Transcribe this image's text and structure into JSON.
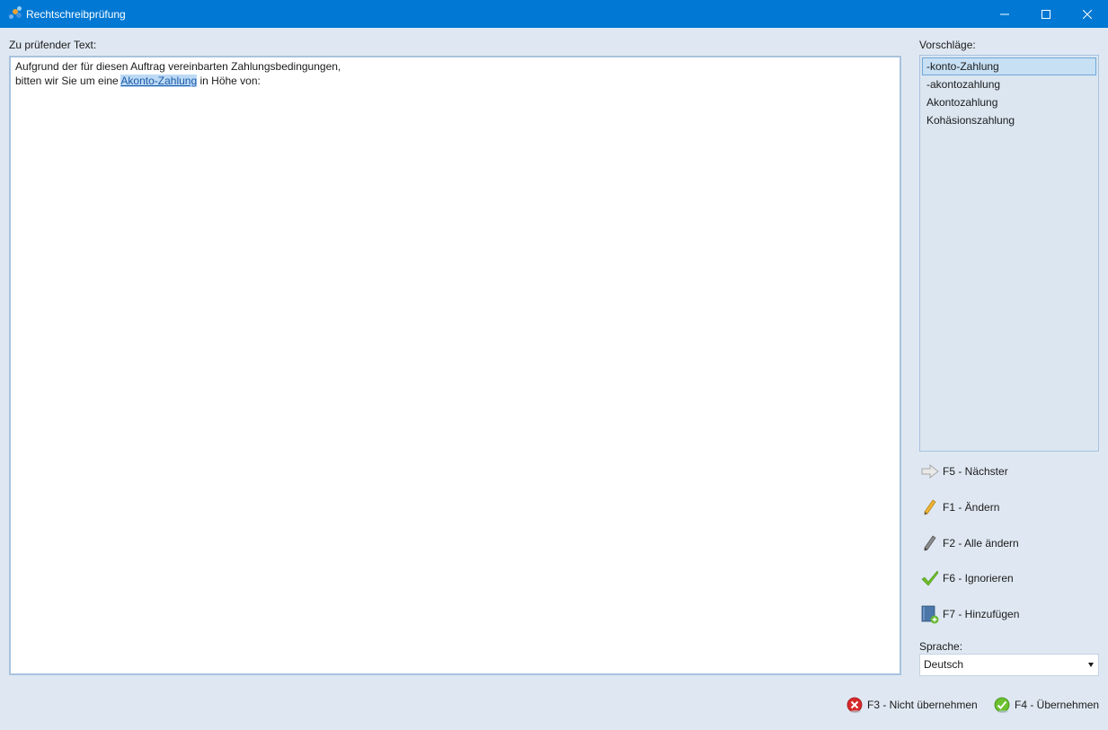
{
  "window": {
    "title": "Rechtschreibprüfung"
  },
  "text_panel": {
    "label": "Zu prüfender Text:",
    "line1": "Aufgrund der für diesen Auftrag vereinbarten Zahlungsbedingungen,",
    "line2_before": "bitten wir Sie um eine ",
    "line2_highlight": "Akonto-Zahlung",
    "line2_after": " in Höhe von:"
  },
  "suggestions": {
    "label": "Vorschläge:",
    "items": [
      "-konto-Zahlung",
      "-akontozahlung",
      "Akontozahlung",
      "Kohäsionszahlung"
    ],
    "selected_index": 0
  },
  "actions": {
    "next": {
      "label": "F5 - Nächster",
      "icon": "arrow-right-icon"
    },
    "change": {
      "label": "F1 - Ändern",
      "icon": "pencil-icon"
    },
    "change_all": {
      "label": "F2 - Alle ändern",
      "icon": "pencil-gray-icon"
    },
    "ignore": {
      "label": "F6 - Ignorieren",
      "icon": "checkmark-icon"
    },
    "add": {
      "label": "F7 - Hinzufügen",
      "icon": "dictionary-add-icon"
    }
  },
  "language": {
    "label": "Sprache:",
    "value": "Deutsch"
  },
  "footer": {
    "cancel": {
      "label": "F3 - Nicht übernehmen",
      "icon": "red-x-icon"
    },
    "apply": {
      "label": "F4 - Übernehmen",
      "icon": "green-check-icon"
    }
  },
  "colors": {
    "titlebar": "#0078d4",
    "background": "#dfe8f2",
    "selection": "#c7e0f4",
    "highlight": "#bcd9f5"
  }
}
